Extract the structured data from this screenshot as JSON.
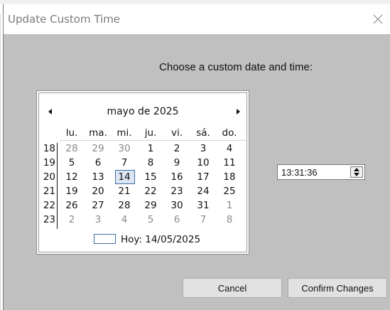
{
  "window": {
    "title": "Update Custom Time"
  },
  "prompt": "Choose a custom date and time:",
  "calendar": {
    "month_title": "mayo de 2025",
    "weekdays": [
      "lu.",
      "ma.",
      "mi.",
      "ju.",
      "vi.",
      "sá.",
      "do."
    ],
    "week_numbers": [
      "18",
      "19",
      "20",
      "21",
      "22",
      "23"
    ],
    "weeks": [
      [
        "28",
        "29",
        "30",
        "1",
        "2",
        "3",
        "4"
      ],
      [
        "5",
        "6",
        "7",
        "8",
        "9",
        "10",
        "11"
      ],
      [
        "12",
        "13",
        "14",
        "15",
        "16",
        "17",
        "18"
      ],
      [
        "19",
        "20",
        "21",
        "22",
        "23",
        "24",
        "25"
      ],
      [
        "26",
        "27",
        "28",
        "29",
        "30",
        "31",
        "1"
      ],
      [
        "2",
        "3",
        "4",
        "5",
        "6",
        "7",
        "8"
      ]
    ],
    "selected_day": "14",
    "today_label": "Hoy: 14/05/2025"
  },
  "time": {
    "value": "13:31:36"
  },
  "buttons": {
    "cancel": "Cancel",
    "confirm": "Confirm Changes"
  },
  "icons": {
    "close": "close-icon",
    "prev": "chevron-left-icon",
    "next": "chevron-right-icon",
    "spin_up": "spin-up-icon",
    "spin_down": "spin-down-icon"
  },
  "colors": {
    "dialog_bg": "#c0c0c0",
    "title_text": "#7a7a7a",
    "today_border": "#3b6ea5",
    "other_month_text": "#8a8a8a"
  }
}
